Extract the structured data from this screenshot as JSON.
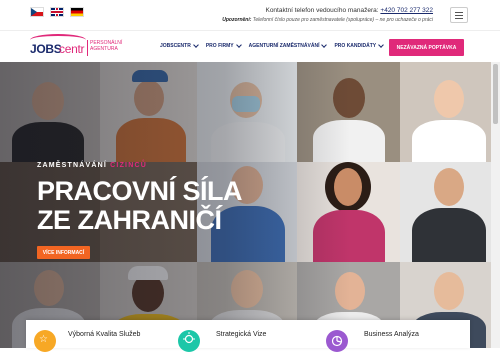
{
  "topbar": {
    "flags": [
      "cz-flag",
      "uk-flag",
      "de-flag"
    ],
    "contact_label": "Kontaktní telefon vedoucího manažera:",
    "contact_phone": "+420 702 277 322",
    "notice_label": "Upozornění:",
    "notice_text": "Telefonní číslo pouze pro zaměstnavatele (spolupráce) – ne pro uchazeče o práci"
  },
  "logo": {
    "jobs": "JOBS",
    "centr": "centr",
    "tag_line1": "PERSONÁLNÍ",
    "tag_line2": "AGENTURA"
  },
  "nav": {
    "items": [
      {
        "label": "JOBSCENTR"
      },
      {
        "label": "PRO FIRMY"
      },
      {
        "label": "AGENTURNÍ ZAMĚSTNÁVÁNÍ"
      },
      {
        "label": "PRO KANDIDÁTY"
      }
    ],
    "cta_label": "NEZÁVAZNÁ POPTÁVKA"
  },
  "hero": {
    "subtitle_prefix": "ZAMĚSTNÁVÁNÍ",
    "subtitle_accent": "CIZINCŮ",
    "title_line1": "PRACOVNÍ SÍLA",
    "title_line2": "ZE ZAHRANIČÍ",
    "button_label": "VÍCE INFORMACÍ"
  },
  "features": [
    {
      "label": "Výborná Kvalita Služeb",
      "icon": "star-icon",
      "color": "#f7a825"
    },
    {
      "label": "Strategická Vize",
      "icon": "bulb-icon",
      "color": "#1cc7a8"
    },
    {
      "label": "Business Analýza",
      "icon": "chart-icon",
      "color": "#9b59d0"
    }
  ],
  "colors": {
    "brand_navy": "#1a2a6c",
    "brand_pink": "#e0297a",
    "hero_button": "#f26522"
  }
}
